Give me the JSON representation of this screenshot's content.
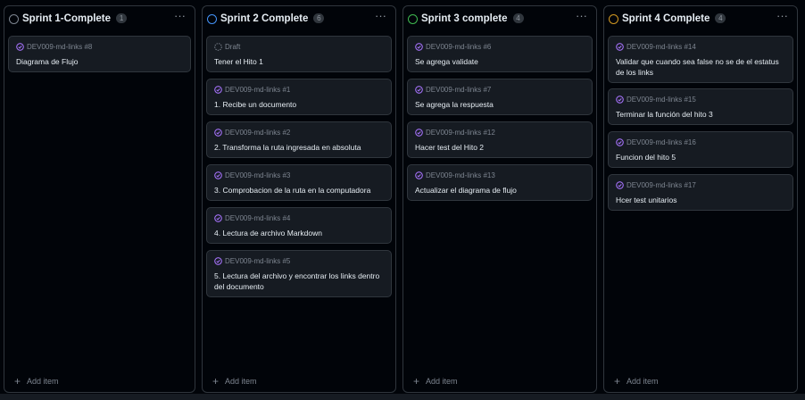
{
  "columns": [
    {
      "title": "Sprint 1-Complete",
      "count": "1",
      "status_color": "#7d8590",
      "add_item_label": "Add item",
      "cards": [
        {
          "meta": "DEV009-md-links #8",
          "title": "Diagrama de Flujo",
          "state": "closed"
        }
      ]
    },
    {
      "title": "Sprint 2 Complete",
      "count": "6",
      "status_color": "#4493f8",
      "add_item_label": "Add item",
      "cards": [
        {
          "meta": "Draft",
          "title": "Tener el Hito 1",
          "state": "draft"
        },
        {
          "meta": "DEV009-md-links #1",
          "title": "1. Recibe un documento",
          "state": "closed"
        },
        {
          "meta": "DEV009-md-links #2",
          "title": "2. Transforma la ruta ingresada en absoluta",
          "state": "closed"
        },
        {
          "meta": "DEV009-md-links #3",
          "title": "3. Comprobacion de la ruta en la computadora",
          "state": "closed"
        },
        {
          "meta": "DEV009-md-links #4",
          "title": "4. Lectura de archivo Markdown",
          "state": "closed"
        },
        {
          "meta": "DEV009-md-links #5",
          "title": "5. Lectura del archivo y encontrar los links dentro del documento",
          "state": "closed"
        }
      ]
    },
    {
      "title": "Sprint 3 complete",
      "count": "4",
      "status_color": "#3fb950",
      "add_item_label": "Add item",
      "cards": [
        {
          "meta": "DEV009-md-links #6",
          "title": "Se agrega validate",
          "state": "closed"
        },
        {
          "meta": "DEV009-md-links #7",
          "title": "Se agrega la respuesta",
          "state": "closed"
        },
        {
          "meta": "DEV009-md-links #12",
          "title": "Hacer test del Hito 2",
          "state": "closed"
        },
        {
          "meta": "DEV009-md-links #13",
          "title": "Actualizar el diagrama de flujo",
          "state": "closed"
        }
      ]
    },
    {
      "title": "Sprint 4 Complete",
      "count": "4",
      "status_color": "#d29922",
      "add_item_label": "Add item",
      "cards": [
        {
          "meta": "DEV009-md-links #14",
          "title": "Validar que cuando sea false no se de el estatus de los links",
          "state": "closed"
        },
        {
          "meta": "DEV009-md-links #15",
          "title": "Terminar la función del hito 3",
          "state": "closed"
        },
        {
          "meta": "DEV009-md-links #16",
          "title": "Funcion del hito 5",
          "state": "closed"
        },
        {
          "meta": "DEV009-md-links #17",
          "title": "Hcer test unitarios",
          "state": "closed"
        }
      ]
    }
  ],
  "icons": {
    "closed_issue": "issue-closed-icon",
    "draft": "draft-icon",
    "menu": "kebab-menu-icon",
    "add": "plus-icon"
  },
  "colors": {
    "closed_issue": "#a371f7",
    "background": "#010409",
    "card": "#161b22",
    "border": "#30363d"
  }
}
